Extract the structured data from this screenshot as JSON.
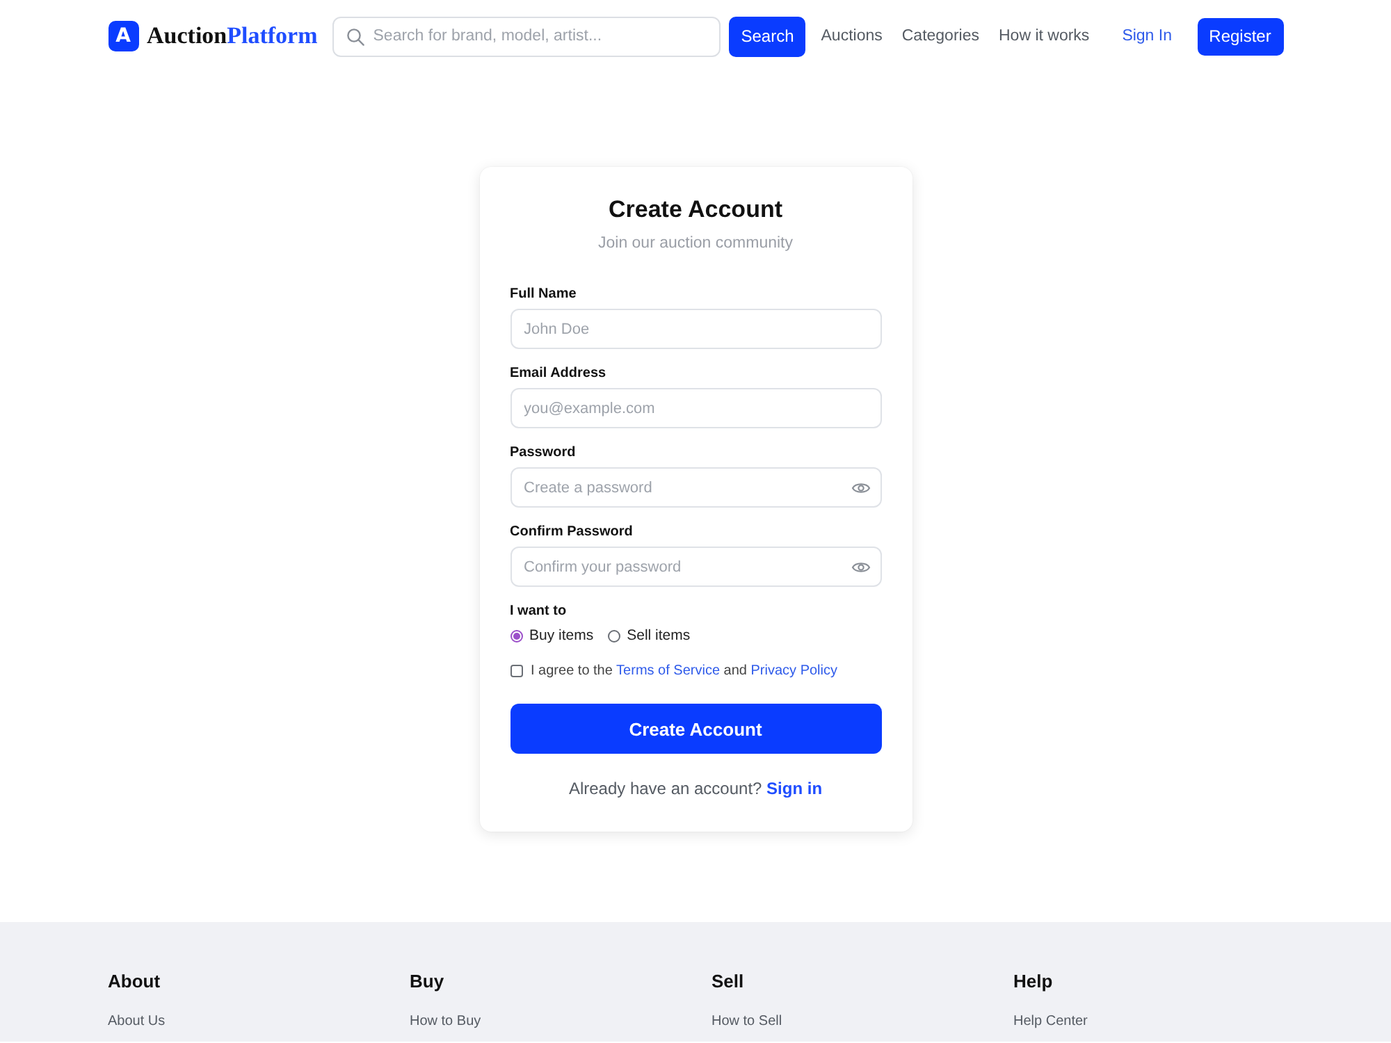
{
  "header": {
    "logo": {
      "badge": "A",
      "text": "Auction",
      "accent": "Platform"
    },
    "search": {
      "placeholder": "Search for brand, model, artist...",
      "button": "Search"
    },
    "nav": [
      "Auctions",
      "Categories",
      "How it works"
    ],
    "sign_in": "Sign In",
    "register": "Register"
  },
  "form": {
    "title": "Create Account",
    "subtitle": "Join our auction community",
    "fields": [
      {
        "label": "Full Name",
        "placeholder": "John Doe",
        "kind": "text"
      },
      {
        "label": "Email Address",
        "placeholder": "you@example.com",
        "kind": "text"
      },
      {
        "label": "Password",
        "placeholder": "Create a password",
        "kind": "password"
      },
      {
        "label": "Confirm Password",
        "placeholder": "Confirm your password",
        "kind": "password"
      }
    ],
    "role": {
      "label": "I want to",
      "options": [
        {
          "label": "Buy items",
          "selected": true
        },
        {
          "label": "Sell items",
          "selected": false
        }
      ]
    },
    "agreement": {
      "checked": false,
      "parts": [
        {
          "kind": "text",
          "text": "I agree to the"
        },
        {
          "kind": "link",
          "text": "Terms of Service"
        },
        {
          "kind": "text",
          "text": "and"
        },
        {
          "kind": "link",
          "text": "Privacy Policy"
        }
      ]
    },
    "submit": "Create Account",
    "signin_prompt": {
      "text": "Already have an account?",
      "link": "Sign in"
    }
  },
  "footer": {
    "columns": [
      {
        "heading": "About",
        "links": [
          "About Us"
        ]
      },
      {
        "heading": "Buy",
        "links": [
          "How to Buy"
        ]
      },
      {
        "heading": "Sell",
        "links": [
          "How to Sell"
        ]
      },
      {
        "heading": "Help",
        "links": [
          "Help Center"
        ]
      }
    ]
  }
}
